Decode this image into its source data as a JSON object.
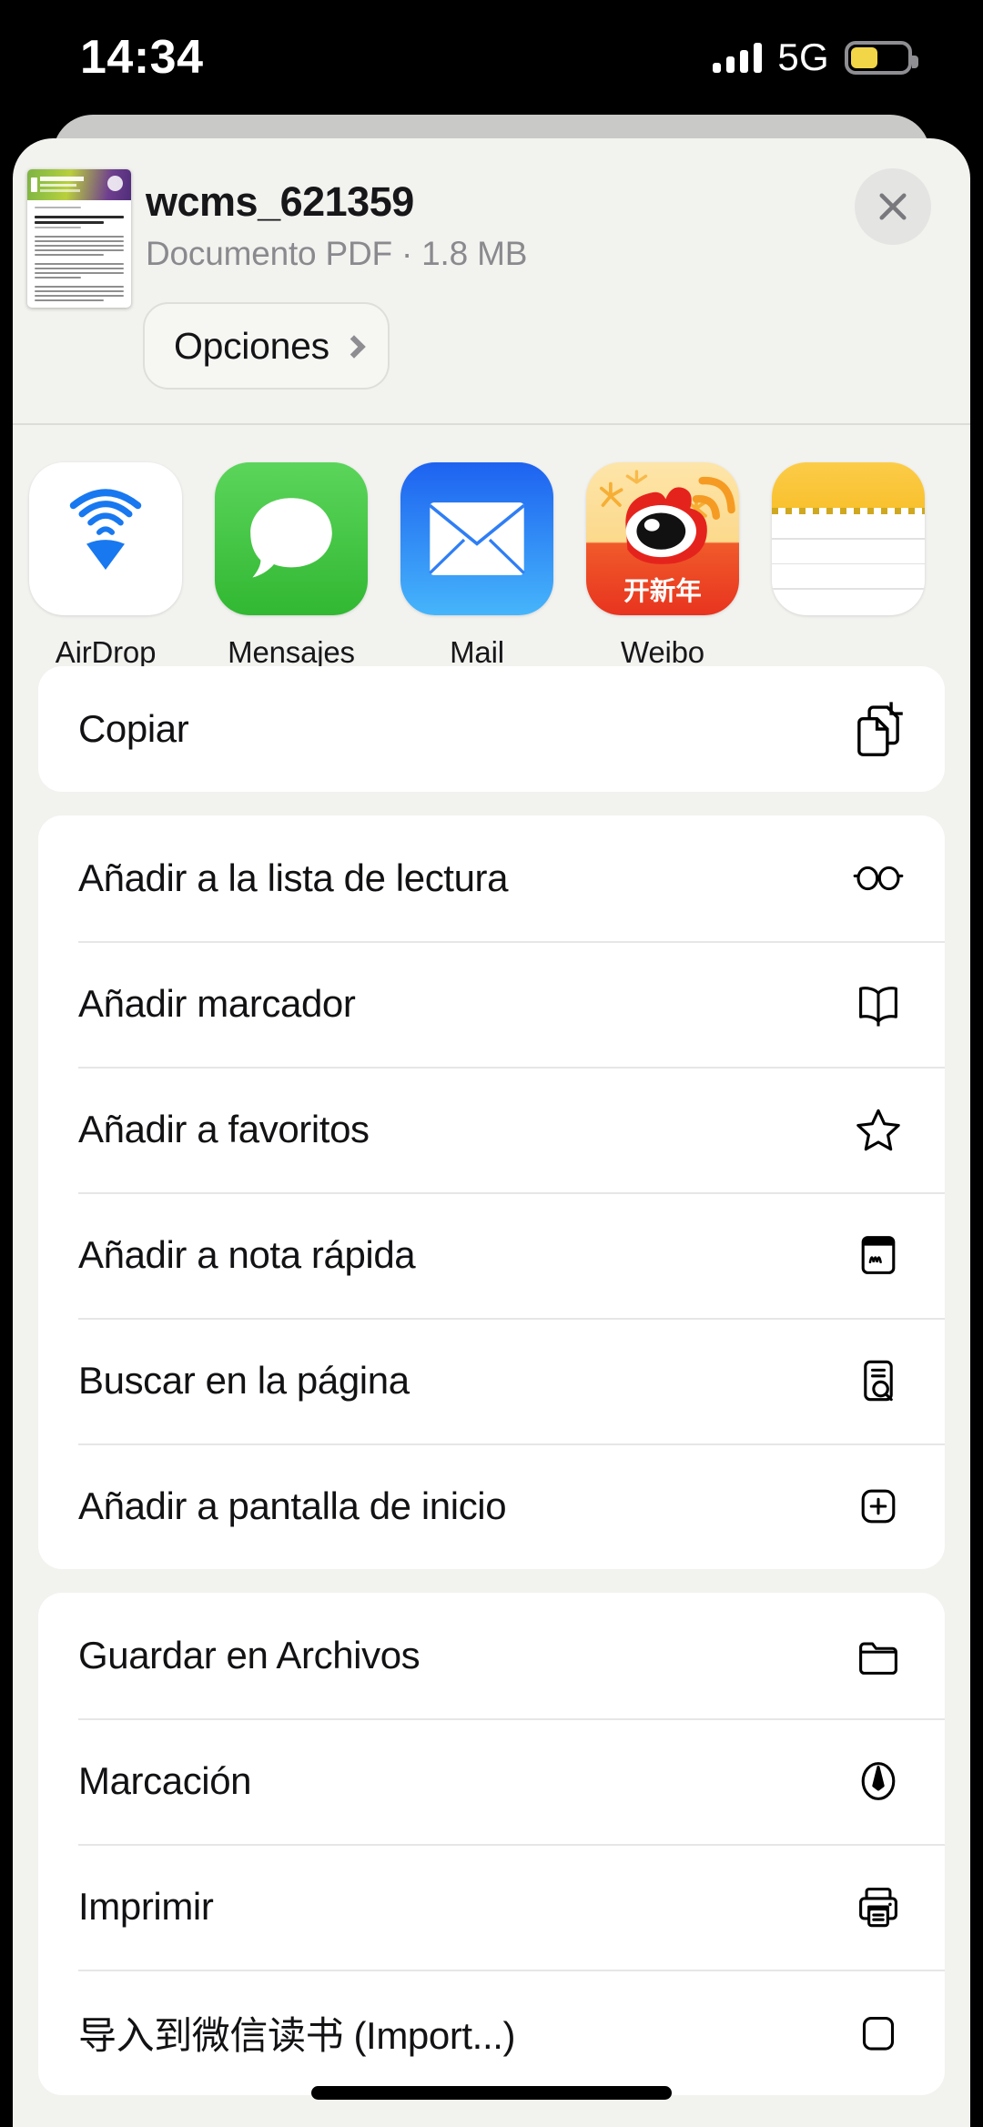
{
  "status_bar": {
    "time": "14:34",
    "network": "5G",
    "signal_icon": "cellular-bars-icon",
    "battery_icon": "battery-low-power-icon",
    "battery_level_percent": 48,
    "battery_color": "#f2d648"
  },
  "share_sheet": {
    "document": {
      "title": "wcms_621359",
      "subtitle": "Documento PDF · 1.8 MB",
      "thumbnail_icon": "pdf-thumbnail"
    },
    "options_button": {
      "label": "Opciones",
      "chevron_icon": "chevron-right-icon"
    },
    "close_button": {
      "icon": "close-icon"
    },
    "apps": [
      {
        "label": "AirDrop",
        "icon": "airdrop-icon"
      },
      {
        "label": "Mensajes",
        "icon": "messages-icon"
      },
      {
        "label": "Mail",
        "icon": "mail-icon"
      },
      {
        "label": "Weibo",
        "icon": "weibo-icon",
        "badge_text": "开新年"
      },
      {
        "label": "",
        "icon": "notes-icon"
      }
    ],
    "action_groups": [
      {
        "items": [
          {
            "label": "Copiar",
            "icon": "copy-icon"
          }
        ]
      },
      {
        "items": [
          {
            "label": "Añadir a la lista de lectura",
            "icon": "glasses-icon"
          },
          {
            "label": "Añadir marcador",
            "icon": "book-icon"
          },
          {
            "label": "Añadir a favoritos",
            "icon": "star-icon"
          },
          {
            "label": "Añadir a nota rápida",
            "icon": "quick-note-icon"
          },
          {
            "label": "Buscar en la página",
            "icon": "find-in-page-icon"
          },
          {
            "label": "Añadir a pantalla de inicio",
            "icon": "add-to-home-icon"
          }
        ]
      },
      {
        "items": [
          {
            "label": "Guardar en Archivos",
            "icon": "folder-icon"
          },
          {
            "label": "Marcación",
            "icon": "markup-pen-icon"
          },
          {
            "label": "Imprimir",
            "icon": "printer-icon"
          },
          {
            "label": "导入到微信读书 (Import...)",
            "icon": "import-icon"
          }
        ]
      }
    ]
  },
  "home_indicator": {
    "icon": "home-indicator"
  }
}
